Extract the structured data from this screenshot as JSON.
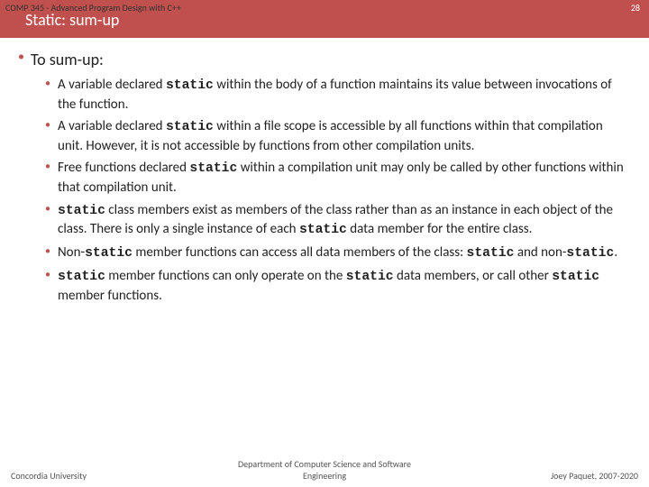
{
  "header": {
    "course": "COMP 345 - Advanced Program Design with C++",
    "number": "28",
    "title": "Static: sum-up"
  },
  "main": {
    "heading": "To sum-up:",
    "kw": "static",
    "bullets": [
      {
        "pre": "A variable declared ",
        "mid": " within the body of a function maintains its value between invocations of the function."
      },
      {
        "pre": "A variable declared ",
        "mid": " within a file scope is accessible by all functions within that compilation unit. However, it is not accessible by functions from other compilation units."
      },
      {
        "pre": "Free functions declared ",
        "mid": " within a compilation unit may only be called by other functions within that compilation unit."
      }
    ],
    "bullet4": {
      "a": " class members exist as members of the class rather than as an instance in each object of the class. There is only a single instance of each ",
      "b": " data member for the entire class."
    },
    "bullet5": {
      "a": "Non-",
      "b": " member functions can access all data members of the class: ",
      "c": " and non-",
      "d": "."
    },
    "bullet6": {
      "a": " member functions can only operate on the ",
      "b": " data members, or call other ",
      "c": " member functions."
    }
  },
  "footer": {
    "left": "Concordia University",
    "center": "Department of Computer Science and Software Engineering",
    "right": "Joey Paquet, 2007-2020"
  }
}
